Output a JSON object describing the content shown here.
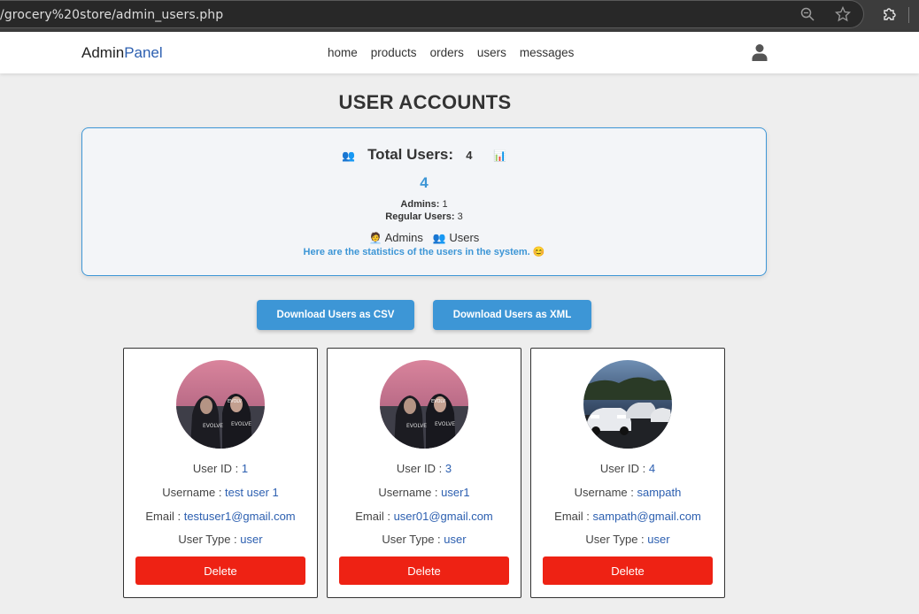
{
  "browser": {
    "url": "/grocery%20store/admin_users.php",
    "icons": [
      "zoom-icon",
      "star-icon",
      "extensions-icon"
    ]
  },
  "header": {
    "logo_part1": "Admin",
    "logo_part2": "Panel",
    "nav": [
      "home",
      "products",
      "orders",
      "users",
      "messages"
    ],
    "user_icon": "user-icon"
  },
  "page_title": "USER ACCOUNTS",
  "stats": {
    "total_label": "Total Users:",
    "total_inline": "4",
    "total_big": "4",
    "admins_label": "Admins:",
    "admins_value": "1",
    "regular_label": "Regular Users:",
    "regular_value": "3",
    "legend_admins": "Admins",
    "legend_users": "Users",
    "note": "Here are the statistics of the users in the system. 😊"
  },
  "downloads": {
    "csv_label": "Download Users as CSV",
    "xml_label": "Download Users as XML"
  },
  "labels": {
    "user_id": "User ID : ",
    "username": "Username : ",
    "email": "Email : ",
    "user_type": "User Type : ",
    "delete": "Delete"
  },
  "users": [
    {
      "id": "1",
      "username": "test user 1",
      "email": "testuser1@gmail.com",
      "type": "user",
      "avatar": "hoodie-portrait"
    },
    {
      "id": "3",
      "username": "user1",
      "email": "user01@gmail.com",
      "type": "user",
      "avatar": "hoodie-portrait"
    },
    {
      "id": "4",
      "username": "sampath",
      "email": "sampath@gmail.com",
      "type": "user",
      "avatar": "cars-photo"
    }
  ],
  "colors": {
    "accent_blue": "#3d96d6",
    "delete_red": "#ee2214",
    "link_blue": "#2c5fb0"
  }
}
